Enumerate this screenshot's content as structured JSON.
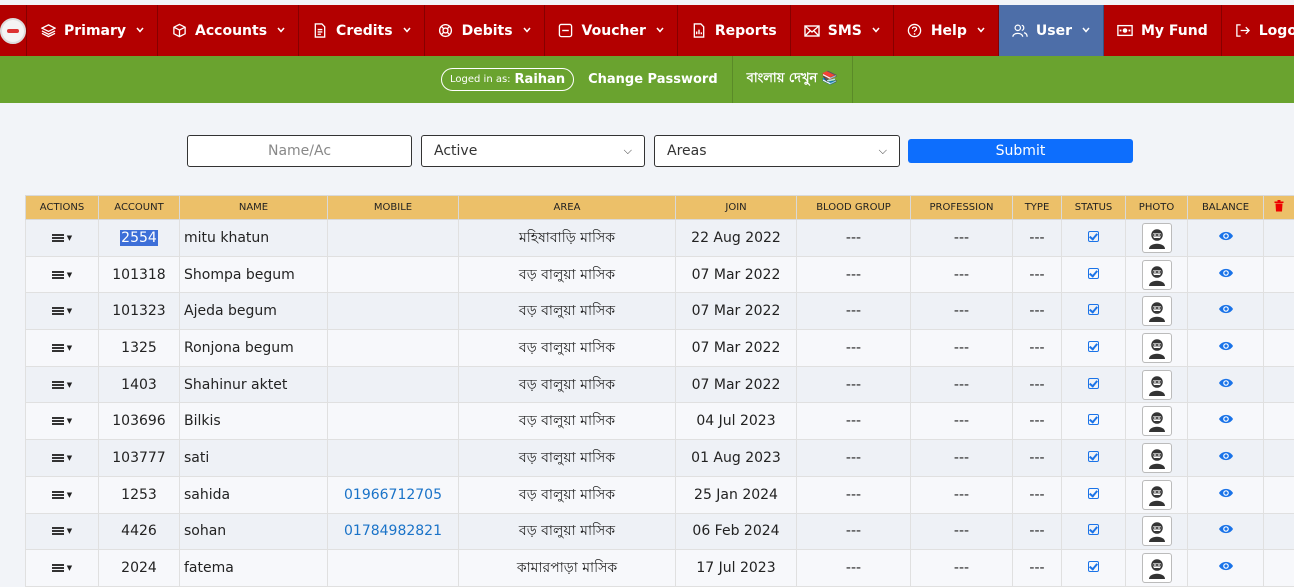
{
  "nav": {
    "items": [
      {
        "label": "Primary",
        "icon": "layers-icon",
        "dropdown": true
      },
      {
        "label": "Accounts",
        "icon": "cube-icon",
        "dropdown": true
      },
      {
        "label": "Credits",
        "icon": "document-icon",
        "dropdown": true
      },
      {
        "label": "Debits",
        "icon": "lifebuoy-icon",
        "dropdown": true
      },
      {
        "label": "Voucher",
        "icon": "minus-square-icon",
        "dropdown": true
      },
      {
        "label": "Reports",
        "icon": "file-chart-icon",
        "dropdown": false
      },
      {
        "label": "SMS",
        "icon": "envelope-icon",
        "dropdown": true
      },
      {
        "label": "Help",
        "icon": "question-icon",
        "dropdown": true
      },
      {
        "label": "User",
        "icon": "users-icon",
        "dropdown": true
      },
      {
        "label": "My Fund",
        "icon": "money-icon",
        "dropdown": false
      },
      {
        "label": "Logout",
        "icon": "logout-icon",
        "dropdown": false
      }
    ]
  },
  "subbar": {
    "logged_in_label": "Loged in as:",
    "username": "Raihan",
    "change_password": "Change Password",
    "bangla_view": "বাংলায় দেখুন 📚"
  },
  "filters": {
    "search_placeholder": "Name/Ac",
    "status_value": "Active",
    "area_value": "Areas",
    "submit_label": "Submit"
  },
  "table": {
    "headers": [
      "ACTIONS",
      "ACCOUNT",
      "NAME",
      "MOBILE",
      "AREA",
      "JOIN",
      "BLOOD GROUP",
      "PROFESSION",
      "TYPE",
      "STATUS",
      "PHOTO",
      "BALANCE"
    ],
    "rows": [
      {
        "account": "2554",
        "name": "mitu khatun",
        "mobile": "",
        "area": "মহিষাবাড়ি মাসিক",
        "join": "22 Aug 2022",
        "blood": "---",
        "profession": "---",
        "type": "---"
      },
      {
        "account": "101318",
        "name": "Shompa begum",
        "mobile": "",
        "area": "বড় বালুয়া মাসিক",
        "join": "07 Mar 2022",
        "blood": "---",
        "profession": "---",
        "type": "---"
      },
      {
        "account": "101323",
        "name": "Ajeda begum",
        "mobile": "",
        "area": "বড় বালুয়া মাসিক",
        "join": "07 Mar 2022",
        "blood": "---",
        "profession": "---",
        "type": "---"
      },
      {
        "account": "1325",
        "name": "Ronjona begum",
        "mobile": "",
        "area": "বড় বালুয়া মাসিক",
        "join": "07 Mar 2022",
        "blood": "---",
        "profession": "---",
        "type": "---"
      },
      {
        "account": "1403",
        "name": "Shahinur aktet",
        "mobile": "",
        "area": "বড় বালুয়া মাসিক",
        "join": "07 Mar 2022",
        "blood": "---",
        "profession": "---",
        "type": "---"
      },
      {
        "account": "103696",
        "name": "Bilkis",
        "mobile": "",
        "area": "বড় বালুয়া মাসিক",
        "join": "04 Jul 2023",
        "blood": "---",
        "profession": "---",
        "type": "---"
      },
      {
        "account": "103777",
        "name": "sati",
        "mobile": "",
        "area": "বড় বালুয়া মাসিক",
        "join": "01 Aug 2023",
        "blood": "---",
        "profession": "---",
        "type": "---"
      },
      {
        "account": "1253",
        "name": "sahida",
        "mobile": "01966712705",
        "area": "বড় বালুয়া মাসিক",
        "join": "25 Jan 2024",
        "blood": "---",
        "profession": "---",
        "type": "---"
      },
      {
        "account": "4426",
        "name": "sohan",
        "mobile": "01784982821",
        "area": "বড় বালুয়া মাসিক",
        "join": "06 Feb 2024",
        "blood": "---",
        "profession": "---",
        "type": "---"
      },
      {
        "account": "2024",
        "name": "fatema",
        "mobile": "",
        "area": "কামারপাড়া মাসিক",
        "join": "17 Jul 2023",
        "blood": "---",
        "profession": "---",
        "type": "---"
      }
    ]
  },
  "colors": {
    "topbar": "#b30000",
    "active_nav": "#4d6ea8",
    "subbar": "#6aa32f",
    "header_row": "#ecc069",
    "submit": "#0d6efd",
    "link": "#1a73c8"
  }
}
